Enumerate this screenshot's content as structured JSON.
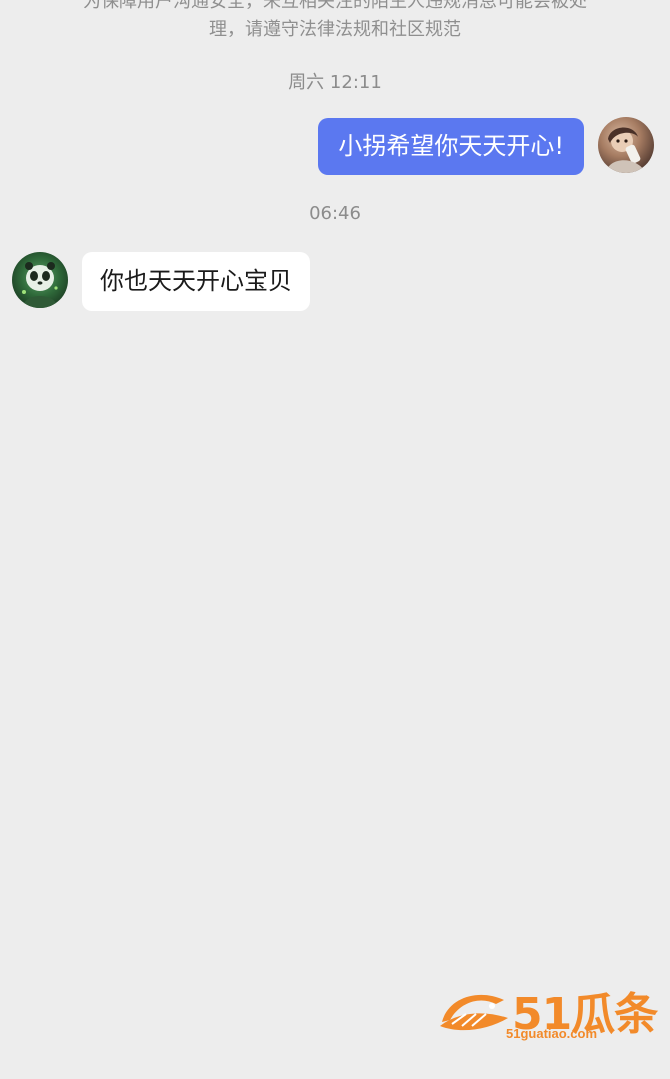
{
  "notice": {
    "line1": "为保障用户沟通安全，未互相关注的陌生人违规消息可能会被处",
    "line2": "理，请遵守法律法规和社区规范"
  },
  "messages": [
    {
      "timestamp": "周六 12:11",
      "sender": "me",
      "text": "小拐希望你天天开心!"
    },
    {
      "timestamp": "06:46",
      "sender": "other",
      "text": "你也天天开心宝贝"
    }
  ],
  "watermark": {
    "brand": "51瓜条",
    "url": "51guatiao.com"
  },
  "colors": {
    "background": "#ededed",
    "my_bubble": "#5b78f0",
    "other_bubble": "#ffffff",
    "watermark": "#f28a2a"
  }
}
